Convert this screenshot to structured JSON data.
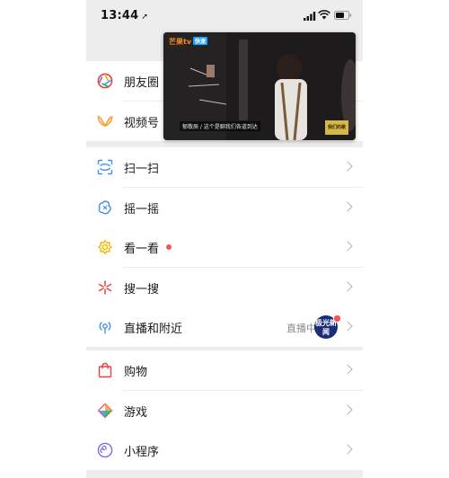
{
  "status_bar": {
    "time": "13:44",
    "location_glyph": "➚"
  },
  "video_overlay": {
    "channel_logo": "芒果tv",
    "channel_tag": "快速",
    "caption": "郁敬辰 / 这个是聊我们各道到达",
    "show_badge": "我们的歌"
  },
  "menu": {
    "groups": [
      {
        "items": [
          {
            "label": "朋友圈",
            "icon": "moments-icon"
          },
          {
            "label": "视频号",
            "icon": "channels-icon"
          }
        ]
      },
      {
        "items": [
          {
            "label": "扫一扫",
            "icon": "scan-icon"
          },
          {
            "label": "摇一摇",
            "icon": "shake-icon"
          }
        ]
      },
      {
        "items": [
          {
            "label": "看一看",
            "icon": "top-stories-icon"
          },
          {
            "label": "搜一搜",
            "icon": "search-icon"
          }
        ]
      },
      {
        "items": [
          {
            "label": "直播和附近",
            "icon": "live-nearby-icon",
            "status": "直播中",
            "avatar_text": "极光新闻"
          }
        ]
      },
      {
        "items": [
          {
            "label": "购物",
            "icon": "shopping-icon"
          },
          {
            "label": "游戏",
            "icon": "games-icon"
          }
        ]
      },
      {
        "items": [
          {
            "label": "小程序",
            "icon": "mini-programs-icon"
          }
        ]
      }
    ]
  },
  "colors": {
    "background": "#ededed",
    "card": "#ffffff",
    "badge_red": "#fa5151",
    "chevron": "#b2b2b2"
  }
}
